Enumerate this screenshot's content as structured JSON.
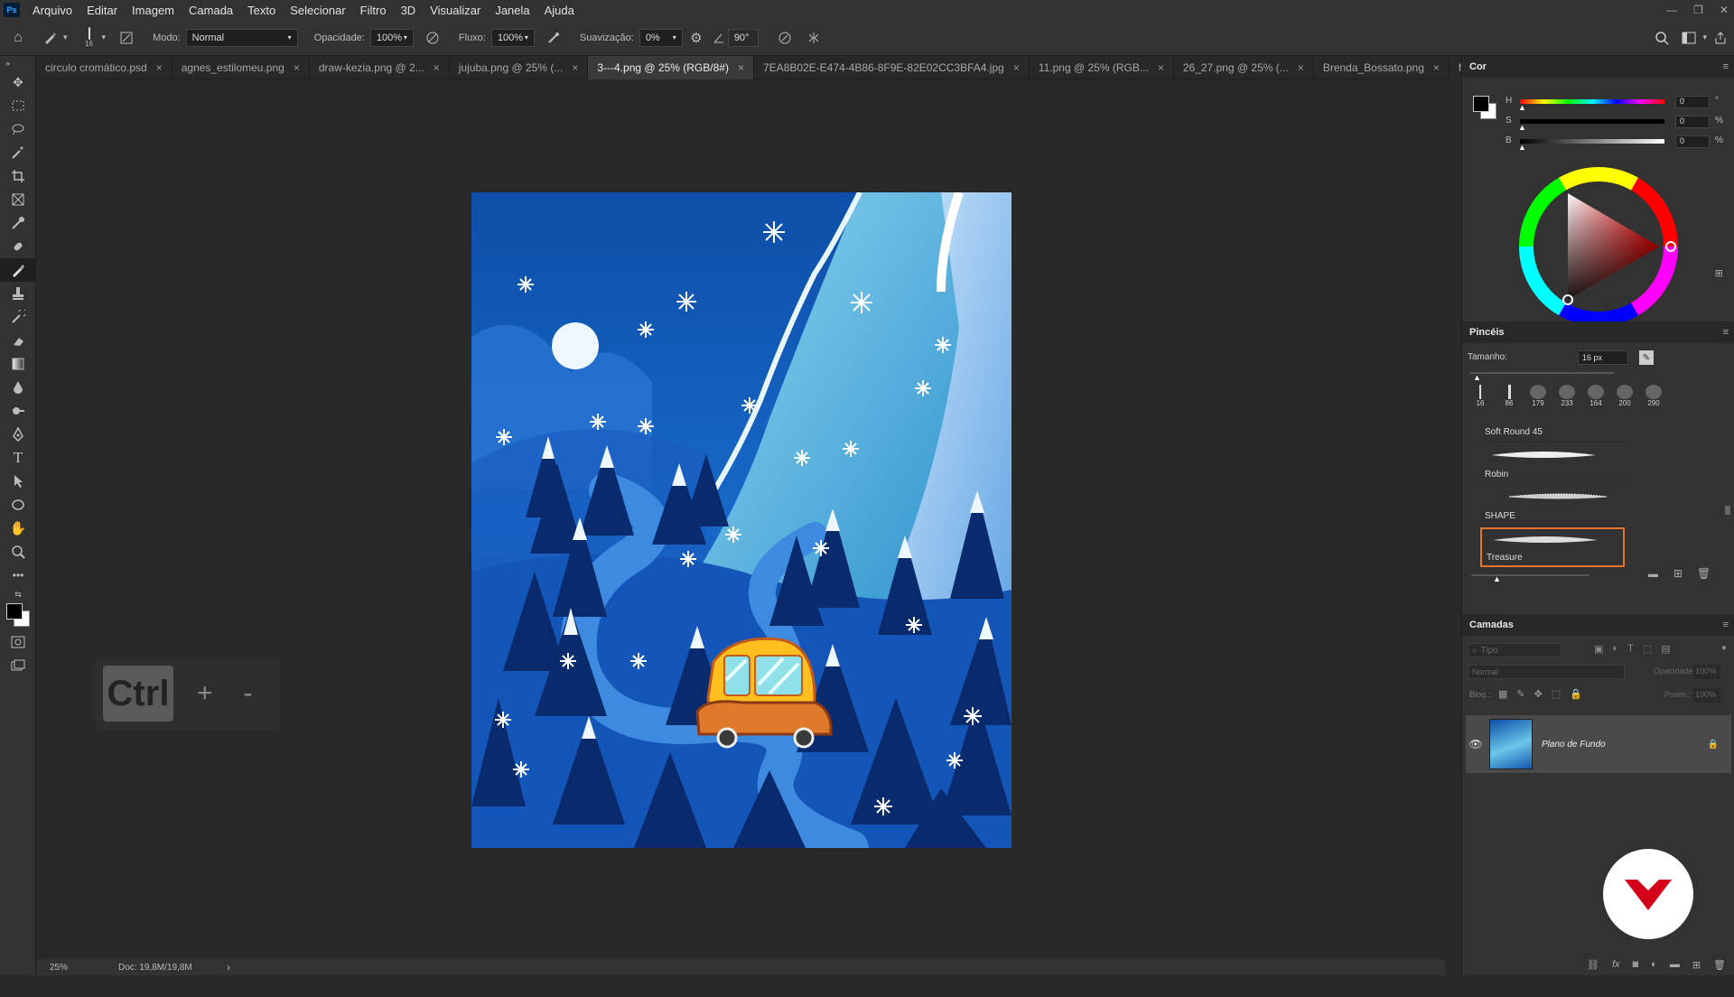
{
  "app": {
    "logo_text": "Ps",
    "name": "Adobe Photoshop"
  },
  "menu": [
    "Arquivo",
    "Editar",
    "Imagem",
    "Camada",
    "Texto",
    "Selecionar",
    "Filtro",
    "3D",
    "Visualizar",
    "Janela",
    "Ajuda"
  ],
  "options": {
    "brush_size": "16",
    "mode_label": "Modo:",
    "mode_value": "Normal",
    "opacity_label": "Opacidade:",
    "opacity_value": "100%",
    "flow_label": "Fluxo:",
    "flow_value": "100%",
    "smoothing_label": "Suavização:",
    "smoothing_value": "0%",
    "angle_value": "90°"
  },
  "tabs": [
    {
      "label": "circulo cromático.psd"
    },
    {
      "label": "agnes_estilomeu.png"
    },
    {
      "label": "draw-kezia.png @ 2..."
    },
    {
      "label": "jujuba.png @ 25% (..."
    },
    {
      "label": "3---4.png @ 25% (RGB/8#)",
      "active": true
    },
    {
      "label": "7EA8B02E-E474-4B86-8F9E-82E02CC3BFA4.jpg"
    },
    {
      "label": "11.png @ 25% (RGB..."
    },
    {
      "label": "26_27.png @ 25% (..."
    },
    {
      "label": "Brenda_Bossato.png"
    },
    {
      "label": "fro"
    }
  ],
  "keycap": {
    "key": "Ctrl",
    "plus": "+",
    "minus": "-"
  },
  "status": {
    "zoom": "25%",
    "doc": "Doc: 19,8M/19,8M",
    "arrow": "›"
  },
  "color_panel": {
    "title": "Cor",
    "h_label": "H",
    "h_value": "0",
    "h_unit": "°",
    "s_label": "S",
    "s_value": "0",
    "s_unit": "%",
    "b_label": "B",
    "b_value": "0",
    "b_unit": "%"
  },
  "brushes_panel": {
    "title": "Pincéis",
    "size_label": "Tamanho:",
    "size_value": "16 px",
    "recent_sizes": [
      "16",
      "86",
      "179",
      "233",
      "164",
      "200",
      "290"
    ],
    "brushes": [
      {
        "name": "Soft Round 45"
      },
      {
        "name": "Robin"
      },
      {
        "name": "SHAPE"
      },
      {
        "name": "Treasure",
        "selected": true
      }
    ]
  },
  "layers_panel": {
    "title": "Camadas",
    "search_placeholder": "Tipo",
    "blend_mode": "Normal",
    "opacity_label": "Opacidade:",
    "opacity_value": "100%",
    "lock_label": "Bloq.:",
    "fill_label": "Preen.:",
    "fill_value": "100%",
    "layers": [
      {
        "name": "Plano de Fundo",
        "visible": true,
        "locked": true
      }
    ]
  },
  "colors": {
    "accent_orange": "#e8742a",
    "brand_red": "#d4001a",
    "active_tab_bg": "#3a3a3a"
  }
}
